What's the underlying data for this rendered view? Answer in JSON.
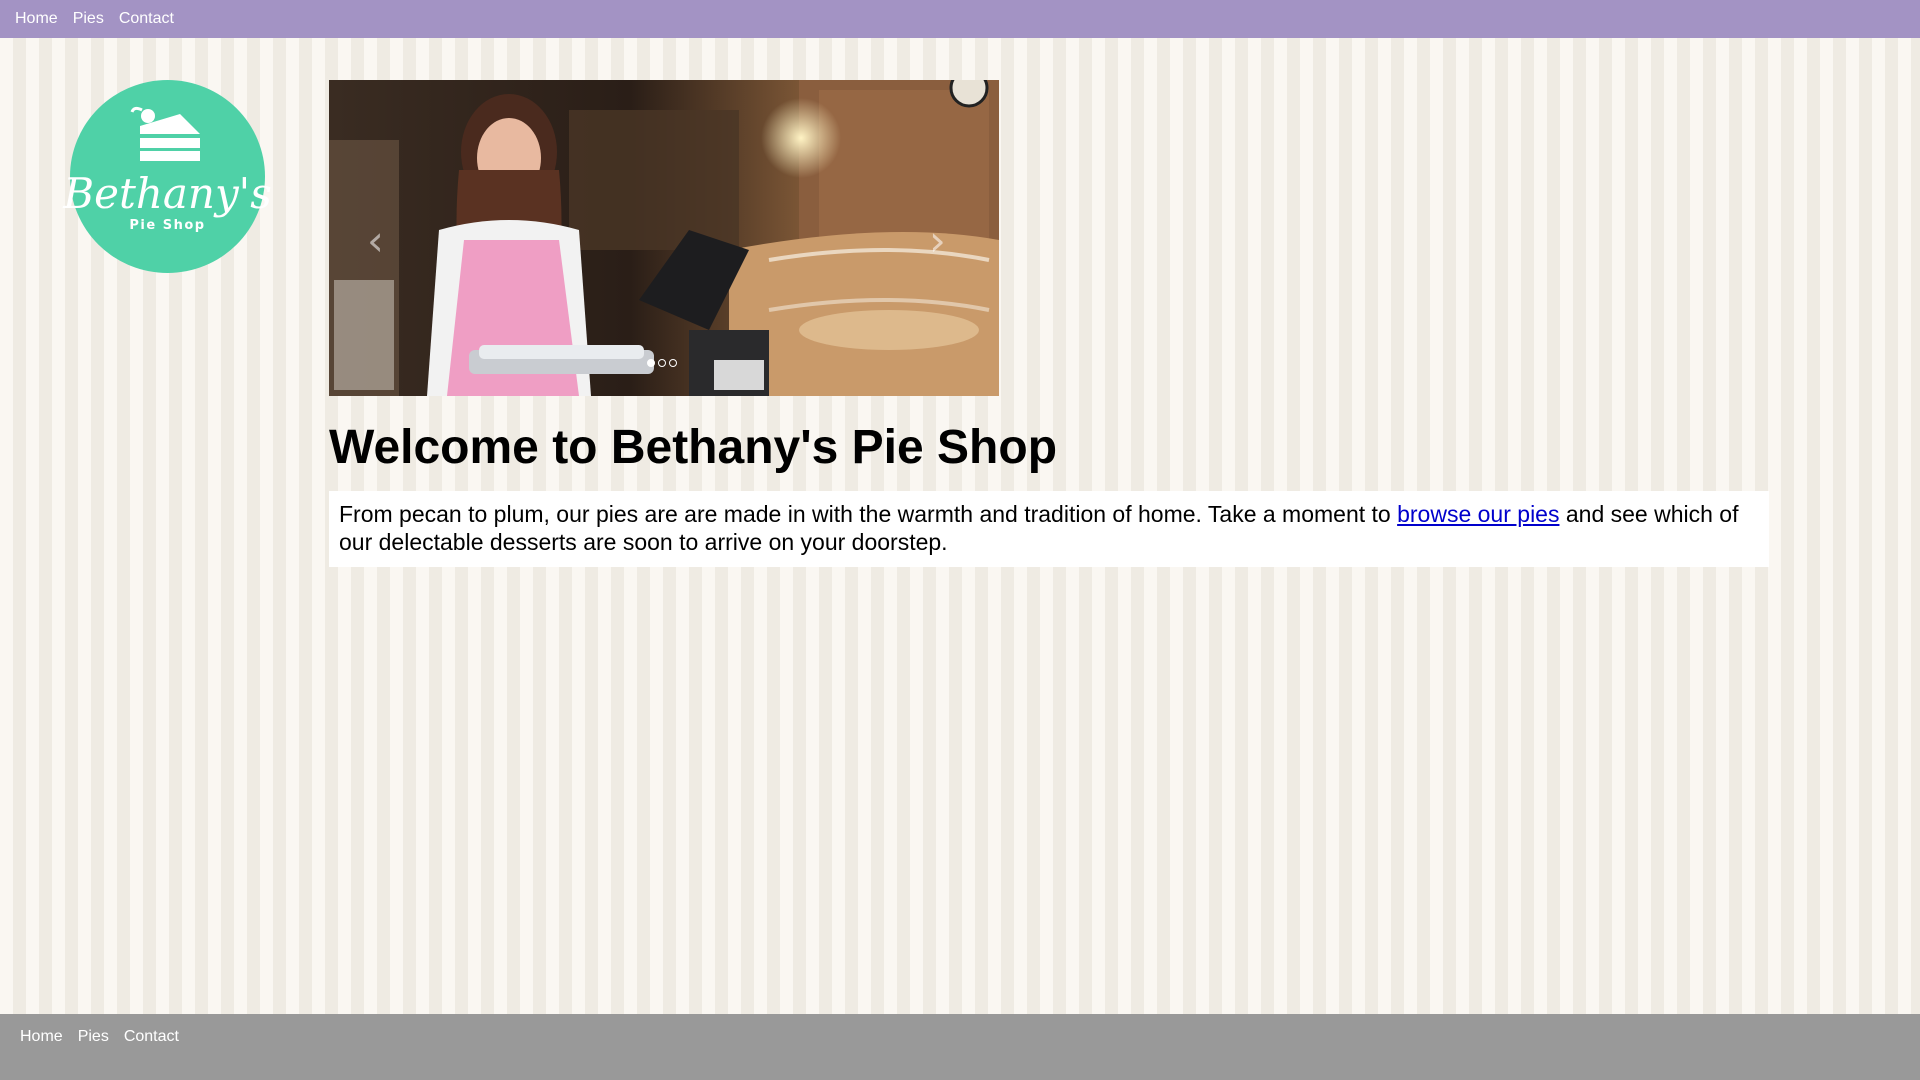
{
  "top_nav": {
    "items": [
      {
        "label": "Home"
      },
      {
        "label": "Pies"
      },
      {
        "label": "Contact"
      }
    ]
  },
  "logo": {
    "script_text": "Bethany's",
    "subtitle": "Pie Shop",
    "color": "#4fd1a7"
  },
  "carousel": {
    "prev_icon": "chevron-left-icon",
    "next_icon": "chevron-right-icon",
    "slide_count": 3,
    "active_index": 0
  },
  "main": {
    "title": "Welcome to Bethany's Pie Shop",
    "intro_before": "From pecan to plum, our pies are are made in with the warmth and tradition of home. Take a moment to ",
    "intro_link": "browse our pies",
    "intro_after": " and see which of our delectable desserts are soon to arrive on your doorstep."
  },
  "footer_nav": {
    "items": [
      {
        "label": "Home"
      },
      {
        "label": "Pies"
      },
      {
        "label": "Contact"
      }
    ]
  },
  "colors": {
    "top_nav_bg": "#a393c4",
    "footer_bg": "#999999",
    "link": "#0000cc"
  }
}
